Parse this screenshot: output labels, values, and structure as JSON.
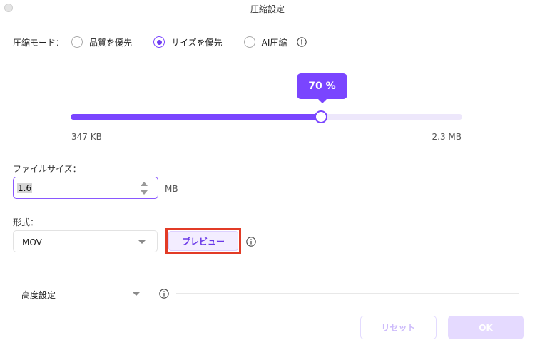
{
  "window": {
    "title": "圧縮設定"
  },
  "mode": {
    "label": "圧縮モード：",
    "options": [
      {
        "label": "品質を優先",
        "selected": false
      },
      {
        "label": "サイズを優先",
        "selected": true
      },
      {
        "label": "AI圧縮",
        "selected": false
      }
    ]
  },
  "slider": {
    "value_label": "70 %",
    "value": 0.64,
    "min_label": "347 KB",
    "max_label": "2.3 MB"
  },
  "file_size": {
    "label": "ファイルサイズ：",
    "value": "1.6",
    "unit": "MB"
  },
  "format": {
    "label": "形式：",
    "selected": "MOV",
    "preview_label": "プレビュー"
  },
  "advanced": {
    "label": "高度設定"
  },
  "footer": {
    "reset_label": "リセット",
    "ok_label": "OK"
  },
  "colors": {
    "accent": "#7a45ff",
    "accent_light": "#ede7fb",
    "highlight": "#e23b26"
  },
  "icons": {
    "info": "info-icon",
    "caret": "chevron-down-icon"
  }
}
